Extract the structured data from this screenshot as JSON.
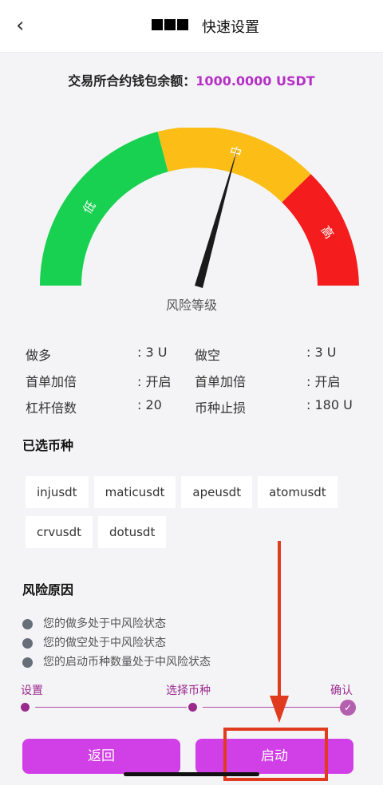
{
  "header": {
    "back_icon": "chevron-left-icon",
    "logo_text": "OKX",
    "title": "快速设置"
  },
  "balance": {
    "label": "交易所合约钱包余额：",
    "amount": "1000.0000 USDT"
  },
  "gauge": {
    "segments": [
      {
        "label": "低",
        "color": "#19d151"
      },
      {
        "label": "中",
        "color": "#fbbd16"
      },
      {
        "label": "高",
        "color": "#f41c1c"
      }
    ],
    "level_label": "风险等级",
    "needle_color": "#1a1a1a"
  },
  "stats": [
    {
      "k1": "做多",
      "v1": ": 3 U",
      "k2": "做空",
      "v2": ": 3 U"
    },
    {
      "k1": "首单加倍",
      "v1": ": 开启",
      "k2": "首单加倍",
      "v2": ": 开启"
    },
    {
      "k1": "杠杆倍数",
      "v1": ": 20",
      "k2": "币种止损",
      "v2": ": 180 U"
    }
  ],
  "coins": {
    "title": "已选币种",
    "items": [
      "injusdt",
      "maticusdt",
      "apeusdt",
      "atomusdt",
      "crvusdt",
      "dotusdt"
    ]
  },
  "reasons": {
    "title": "风险原因",
    "items": [
      "您的做多处于中风险状态",
      "您的做空处于中风险状态",
      "您的启动币种数量处于中风险状态"
    ]
  },
  "steps": {
    "items": [
      "设置",
      "选择币种",
      "确认"
    ]
  },
  "buttons": {
    "back": "返回",
    "start": "启动"
  },
  "colors": {
    "accent": "#d13fe6",
    "amount": "#b530c6",
    "annotation": "#e03a1f"
  }
}
